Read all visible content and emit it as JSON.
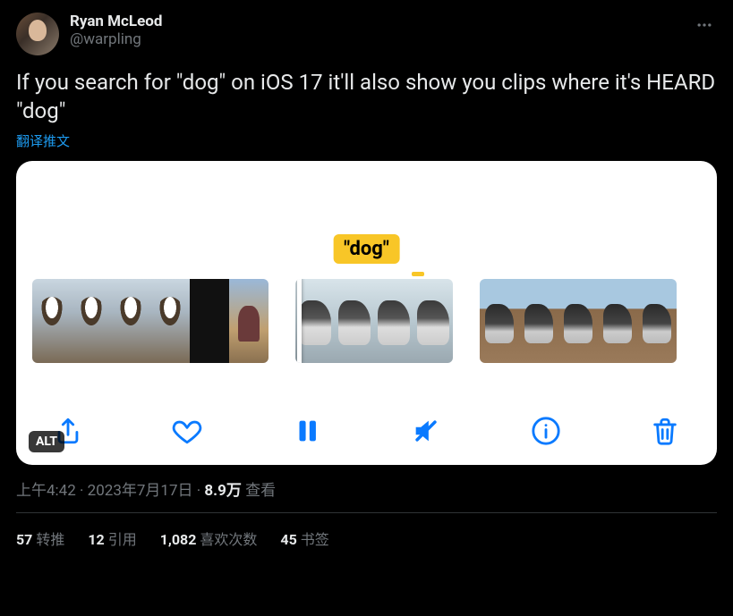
{
  "author": {
    "display_name": "Ryan McLeod",
    "handle": "@warpling"
  },
  "tweet_text": "If you search for \"dog\" on iOS 17 it'll also show you clips where it's HEARD \"dog\"",
  "translate_label": "翻译推文",
  "media": {
    "search_badge": "\"dog\"",
    "alt_badge": "ALT"
  },
  "meta": {
    "time": "上午4:42",
    "date": "2023年7月17日",
    "views_count": "8.9万",
    "views_label": "查看",
    "separator": " · "
  },
  "stats": {
    "retweets_count": "57",
    "retweets_label": "转推",
    "quotes_count": "12",
    "quotes_label": "引用",
    "likes_count": "1,082",
    "likes_label": "喜欢次数",
    "bookmarks_count": "45",
    "bookmarks_label": "书签"
  }
}
